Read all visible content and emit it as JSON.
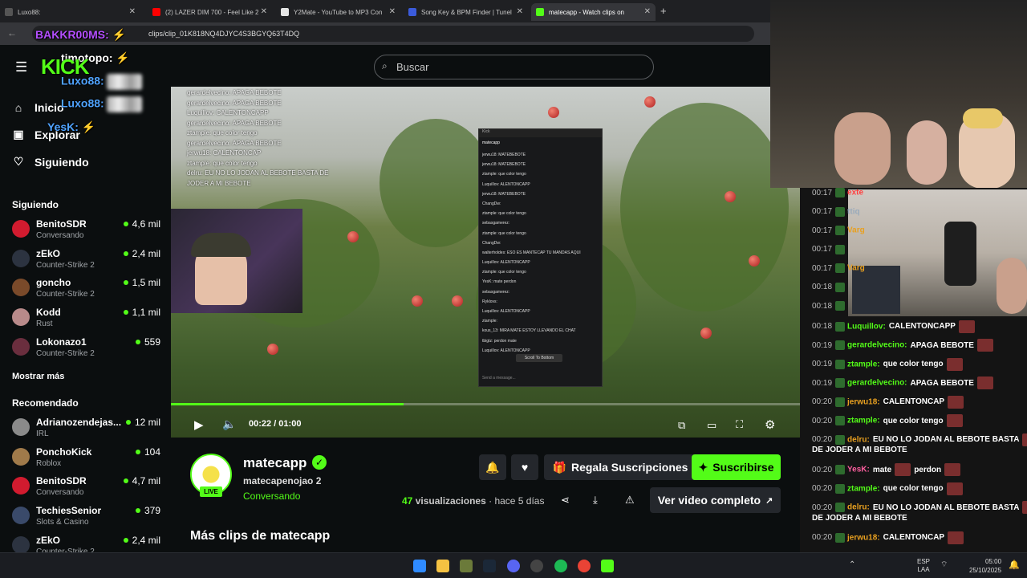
{
  "browser": {
    "tabs": [
      {
        "label": "Luxo88:",
        "color": "#555"
      },
      {
        "label": "(2) LAZER DIM 700 - Feel Like 2",
        "color": "#ff0000"
      },
      {
        "label": "Y2Mate - YouTube to MP3 Con",
        "color": "#e5e5e5"
      },
      {
        "label": "Song Key & BPM Finder | Tunel",
        "color": "#3b5bdb"
      },
      {
        "label": "matecapp - Watch clips on",
        "color": "#53fc18"
      }
    ],
    "url": "clips/clip_01K818NQ4DJYC4S3BGYQ63T4DQ"
  },
  "overlay": {
    "names": [
      "BAKKR00MS:",
      "timotopo:",
      "Luxo88:",
      "Luxo88:",
      "YesK:"
    ],
    "logo": "KICK"
  },
  "sidebar": {
    "nav": [
      {
        "label": "Inicio",
        "icon": "home-icon"
      },
      {
        "label": "Explorar",
        "icon": "compass-icon"
      },
      {
        "label": "Siguiendo",
        "icon": "heart-icon"
      }
    ],
    "following_title": "Siguiendo",
    "following": [
      {
        "name": "BenitoSDR",
        "category": "Conversando",
        "viewers": "4,6 mil",
        "color": "#d21b2f"
      },
      {
        "name": "zEkO",
        "category": "Counter-Strike 2",
        "viewers": "2,4 mil",
        "color": "#2c3340"
      },
      {
        "name": "goncho",
        "category": "Counter-Strike 2",
        "viewers": "1,5 mil",
        "color": "#7a4a2a"
      },
      {
        "name": "Kodd",
        "category": "Rust",
        "viewers": "1,1 mil",
        "color": "#b88a8a"
      },
      {
        "name": "Lokonazo1",
        "category": "Counter-Strike 2",
        "viewers": "559",
        "color": "#6a2e3e"
      }
    ],
    "show_more": "Mostrar más",
    "recommended_title": "Recomendado",
    "recommended": [
      {
        "name": "Adrianozendejas...",
        "category": "IRL",
        "viewers": "12 mil",
        "color": "#8a8a8a"
      },
      {
        "name": "PonchoKick",
        "category": "Roblox",
        "viewers": "104",
        "color": "#a07a4a"
      },
      {
        "name": "BenitoSDR",
        "category": "Conversando",
        "viewers": "4,7 mil",
        "color": "#d21b2f"
      },
      {
        "name": "TechiesSenior",
        "category": "Slots & Casino",
        "viewers": "379",
        "color": "#3a4a6a"
      },
      {
        "name": "zEkO",
        "category": "Counter-Strike 2",
        "viewers": "2,4 mil",
        "color": "#2c3340"
      }
    ]
  },
  "search": {
    "placeholder": "Buscar"
  },
  "player": {
    "time": "00:22 / 01:00",
    "progress": 0.37
  },
  "clip_chat": [
    "gerardelvecino: APAGA BEBOTE",
    "gerardelvecino: APAGA BEBOTE",
    "LuquiIlov: CALENTONCAPP",
    "gerardelvecino: APAGA BEBOTE",
    "ztample: que color tengo",
    "gerardelvecino: APAGA BEBOTE",
    "jerwu18: CALENTONCAP",
    "ztample: que color tengo",
    "delru: EU NO LO JODAN AL BEBOTE BASTA DE JODER A MI BEBOTE"
  ],
  "inner_chat": {
    "channel": "matecapp",
    "lines": [
      "jerwu18: MATEBEBOTE",
      "jerwu18: MATEBEBOTE",
      "ztample: que color tengo",
      "LuquiIlov: ALENTONCAPP",
      "jerwu18: MATEBEBOTE",
      "ChangDw:",
      "ztample: que color tengo",
      "sebasgamerez:",
      "ztample: que color tengo",
      "ChangDw:",
      "walterholdes: ESO ES MANTECAP TU MANDAS AQUI",
      "LuquiIlov: ALENTONCAPP",
      "ztample: que color tengo",
      "YesK: mate perdon",
      "sebasgamerez:",
      "Ryklovs:",
      "LuquiIlov: ALENTONCAPP",
      "ztample:",
      "kous_13: MIRA MATE ESTOY LLEVANDO EL CHAT",
      "tbigtz: perdon mate",
      "LuquiIlov: ALENTONCAPP"
    ],
    "scroll": "Scroll To Bottom",
    "send": "Send a message..."
  },
  "clip": {
    "channel": "matecapp",
    "title": "matecapenojao 2",
    "category": "Conversando",
    "live": "LIVE",
    "views_num": "47",
    "views_label": "visualizaciones",
    "age": "hace 5 días",
    "gift": "Regala Suscripciones",
    "subscribe": "Suscribirse",
    "full_video": "Ver video completo",
    "more_clips": "Más clips de matecapp",
    "accent": "#53fc18"
  },
  "stream_chat": [
    {
      "time": "00:17",
      "user": "exte",
      "msg": "",
      "color": "#ff4040"
    },
    {
      "time": "00:17",
      "user": "ttiq",
      "msg": "",
      "color": "#9ab"
    },
    {
      "time": "00:17",
      "user": "Varg",
      "msg": "",
      "color": "#e8a020"
    },
    {
      "time": "00:17",
      "user": "",
      "msg": "",
      "color": "#fff"
    },
    {
      "time": "00:17",
      "user": "Varg",
      "msg": "",
      "color": "#e8a020"
    },
    {
      "time": "00:18",
      "user": "",
      "msg": "",
      "color": "#fff"
    },
    {
      "time": "00:18",
      "user": "",
      "msg": "",
      "color": "#fff"
    },
    {
      "time": "00:18",
      "user": "Luquillov:",
      "msg": "CALENTONCAPP",
      "color": "#53fc18"
    },
    {
      "time": "00:19",
      "user": "gerardelvecino:",
      "msg": "APAGA BEBOTE",
      "color": "#53fc18"
    },
    {
      "time": "00:19",
      "user": "ztample:",
      "msg": "que color tengo",
      "color": "#53fc18"
    },
    {
      "time": "00:19",
      "user": "gerardelvecino:",
      "msg": "APAGA BEBOTE",
      "color": "#53fc18"
    },
    {
      "time": "00:20",
      "user": "jerwu18:",
      "msg": "CALENTONCAP",
      "color": "#e8a020"
    },
    {
      "time": "00:20",
      "user": "ztample:",
      "msg": "que color tengo",
      "color": "#53fc18"
    },
    {
      "time": "00:20",
      "user": "delru:",
      "msg": "EU NO LO JODAN AL BEBOTE BASTA",
      "msg2": "DE JODER A MI BEBOTE",
      "color": "#e8a020"
    },
    {
      "time": "00:20",
      "user": "YesK:",
      "msg": "mate",
      "msg3": "perdon",
      "color": "#ff5fa0"
    },
    {
      "time": "00:20",
      "user": "ztample:",
      "msg": "que color tengo",
      "color": "#53fc18"
    },
    {
      "time": "00:20",
      "user": "delru:",
      "msg": "EU NO LO JODAN AL BEBOTE BASTA",
      "msg2": "DE JODER A MI BEBOTE",
      "color": "#e8a020"
    },
    {
      "time": "00:20",
      "user": "jerwu18:",
      "msg": "CALENTONCAP",
      "color": "#e8a020"
    }
  ],
  "taskbar": {
    "lang": "ESP",
    "lang2": "LAA",
    "time": "05:00",
    "date": "25/10/2025"
  }
}
